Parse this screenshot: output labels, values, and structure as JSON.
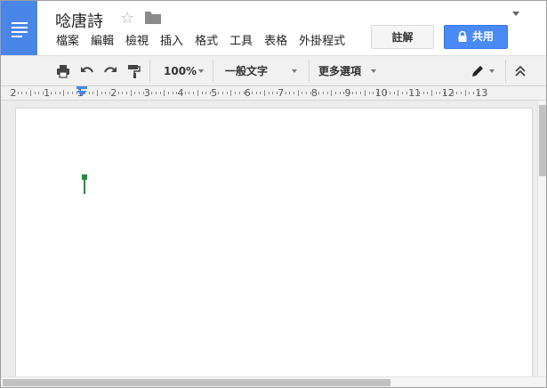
{
  "document": {
    "title": "唸唐詩"
  },
  "menubar": {
    "items": [
      "檔案",
      "編輯",
      "檢視",
      "插入",
      "格式",
      "工具",
      "表格",
      "外掛程式"
    ]
  },
  "actions": {
    "comments_label": "註解",
    "share_label": "共用"
  },
  "toolbar": {
    "zoom": "100%",
    "style": "一般文字",
    "more": "更多選項"
  },
  "ruler": {
    "labels": [
      "2",
      "1",
      "1",
      "2",
      "3",
      "4",
      "5",
      "6",
      "7",
      "8",
      "9",
      "10",
      "11",
      "12",
      "13"
    ]
  },
  "colors": {
    "brand": "#4a86e8",
    "share_button": "#4a8af4",
    "cursor": "#1e8e3e"
  },
  "icons": [
    "docs-logo-icon",
    "star-icon",
    "folder-icon",
    "lock-icon",
    "print-icon",
    "undo-icon",
    "redo-icon",
    "paint-format-icon",
    "pen-icon",
    "collapse-toolbar-icon"
  ]
}
